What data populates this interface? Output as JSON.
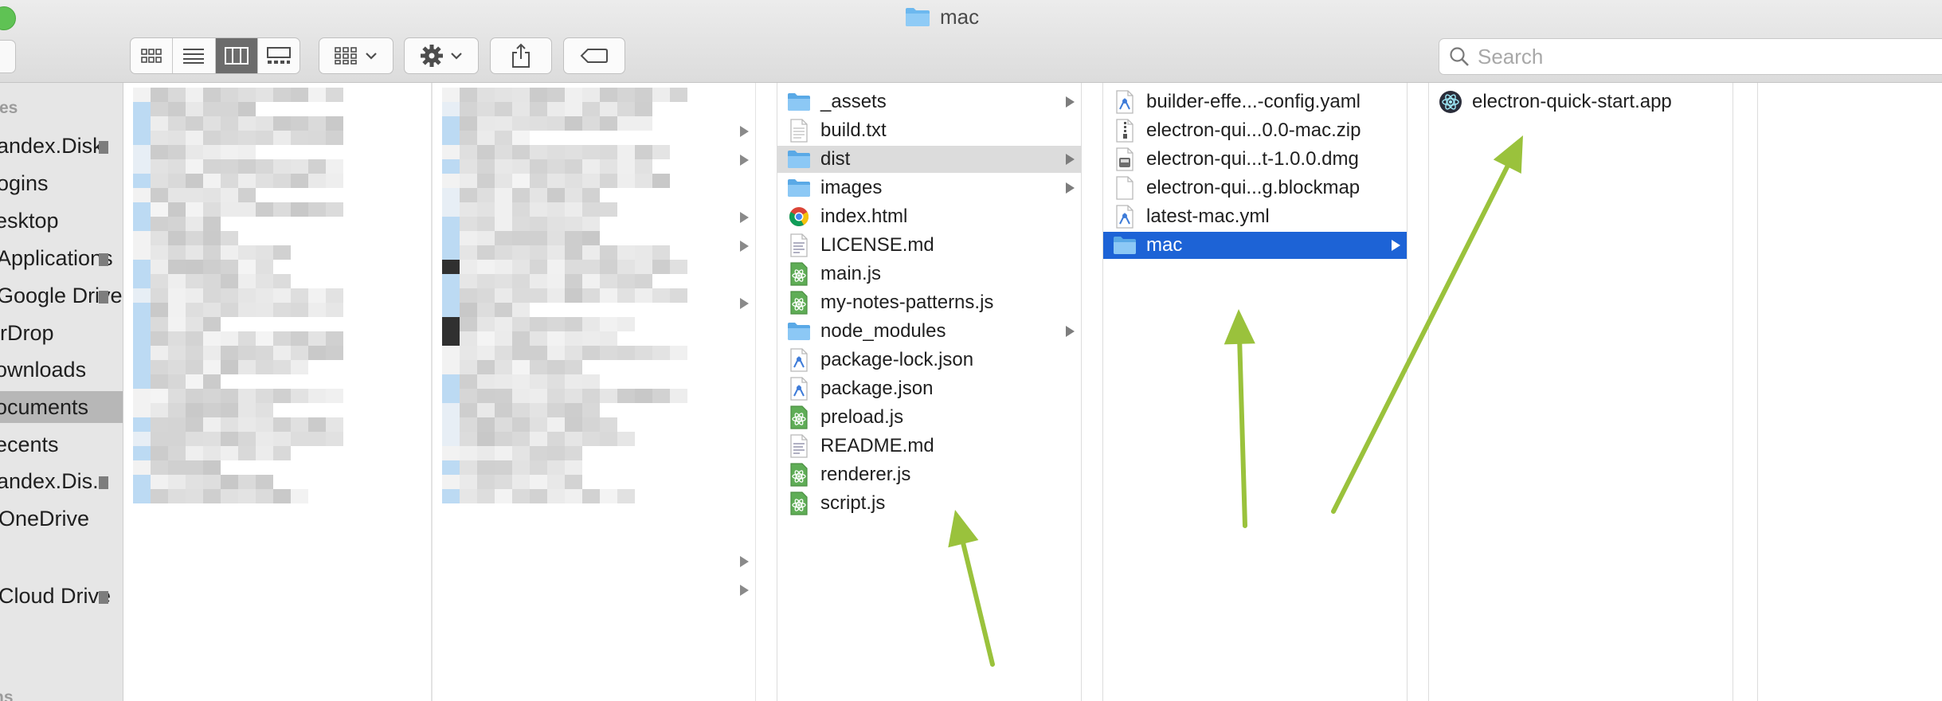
{
  "window": {
    "title": "mac",
    "title_icon": "folder-icon",
    "traffic_light_color": "#5fc254"
  },
  "toolbar": {
    "view_buttons": [
      "icon-view-icon",
      "list-view-icon",
      "column-view-icon",
      "gallery-view-icon"
    ],
    "active_view": "column-view-icon",
    "group_button_icon": "group-grid-icon",
    "action_button_icon": "gear-icon",
    "share_button_icon": "share-icon",
    "tag_button_icon": "tag-icon",
    "search_placeholder": "Search"
  },
  "sidebar": {
    "favorites_heading": "tes",
    "locations_heading": "ns",
    "items": [
      {
        "label": "andex.Disk",
        "eject": true
      },
      {
        "label": "ogins"
      },
      {
        "label": "esktop"
      },
      {
        "label": "Applications",
        "eject": true
      },
      {
        "label": "Google Drive",
        "eject": true
      },
      {
        "label": "irDrop"
      },
      {
        "label": "ownloads"
      },
      {
        "label": "ocuments",
        "selected": true
      },
      {
        "label": "ecents"
      },
      {
        "label": "andex.Dis.",
        "eject": true
      },
      {
        "label": "OneDrive"
      },
      {
        "label": "Cloud Drive",
        "eject": true
      }
    ]
  },
  "columns": {
    "project": [
      {
        "name": "_assets",
        "icon": "folder-icon",
        "children": true
      },
      {
        "name": "build.txt",
        "icon": "text-file-icon"
      },
      {
        "name": "dist",
        "icon": "folder-icon",
        "children": true,
        "state": "selected-inactive"
      },
      {
        "name": "images",
        "icon": "folder-icon",
        "children": true
      },
      {
        "name": "index.html",
        "icon": "html-file-icon"
      },
      {
        "name": "LICENSE.md",
        "icon": "markdown-file-icon"
      },
      {
        "name": "main.js",
        "icon": "js-file-icon"
      },
      {
        "name": "my-notes-patterns.js",
        "icon": "js-file-icon"
      },
      {
        "name": "node_modules",
        "icon": "folder-icon",
        "children": true
      },
      {
        "name": "package-lock.json",
        "icon": "json-file-icon"
      },
      {
        "name": "package.json",
        "icon": "json-file-icon"
      },
      {
        "name": "preload.js",
        "icon": "js-file-icon"
      },
      {
        "name": "README.md",
        "icon": "markdown-file-icon"
      },
      {
        "name": "renderer.js",
        "icon": "js-file-icon"
      },
      {
        "name": "script.js",
        "icon": "js-file-icon"
      }
    ],
    "dist": [
      {
        "name": "builder-effe...-config.yaml",
        "icon": "yaml-file-icon"
      },
      {
        "name": "electron-qui...0.0-mac.zip",
        "icon": "zip-file-icon"
      },
      {
        "name": "electron-qui...t-1.0.0.dmg",
        "icon": "dmg-file-icon"
      },
      {
        "name": "electron-qui...g.blockmap",
        "icon": "blank-file-icon"
      },
      {
        "name": "latest-mac.yml",
        "icon": "yaml-file-icon"
      },
      {
        "name": "mac",
        "icon": "folder-icon",
        "children": true,
        "state": "selected-active"
      }
    ],
    "mac": [
      {
        "name": "electron-quick-start.app",
        "icon": "electron-app-icon"
      }
    ]
  },
  "annotations": {
    "arrow_color": "#9ac23c"
  }
}
